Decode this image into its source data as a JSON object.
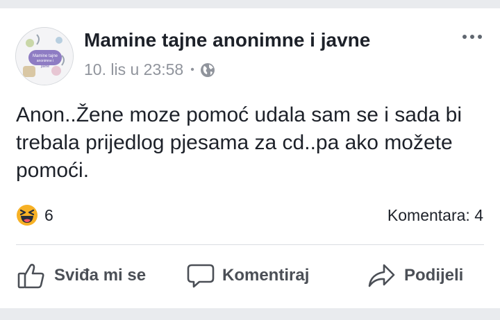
{
  "post": {
    "group_name": "Mamine tajne anonimne i javne",
    "avatar_text": "Mamine tajne anonimne i javne",
    "timestamp": "10. lis u 23:58",
    "meta_separator": "•",
    "privacy_icon": "globe-icon",
    "text": "Anon..Žene moze pomoć udala sam se i sada bi trebala prijedlog pjesama za cd..pa ako možete pomoći.",
    "reaction_icon": "haha-emoji-icon",
    "reaction_count": "6",
    "comments_label": "Komentara: 4"
  },
  "actions": {
    "like_label": "Sviđa mi se",
    "comment_label": "Komentiraj",
    "share_label": "Podijeli"
  },
  "colors": {
    "name": "#1d2129",
    "meta": "#90949c",
    "action": "#4b4f56",
    "reaction": "#f7b125"
  }
}
